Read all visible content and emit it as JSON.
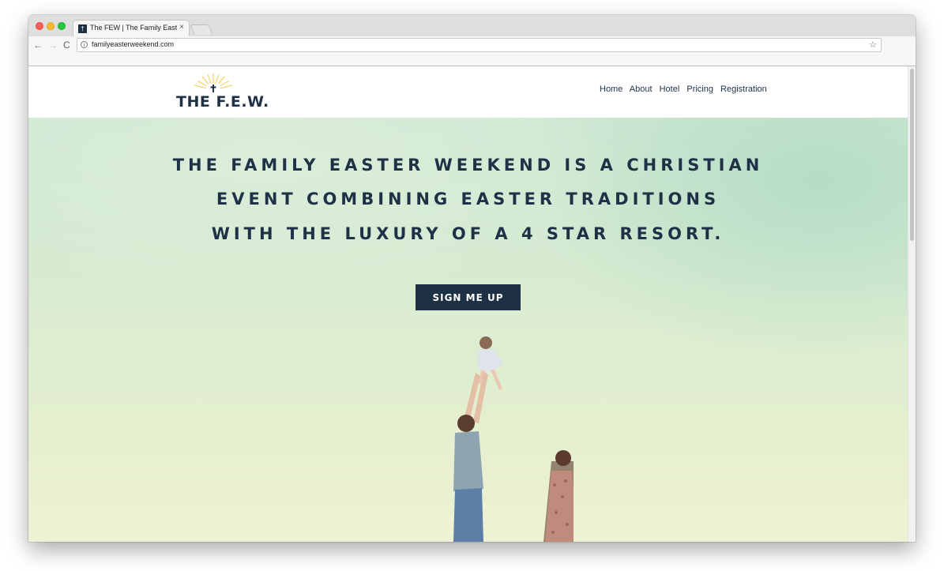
{
  "browser": {
    "tab_title": "The FEW | The Family Easter W",
    "tab_close": "×",
    "favicon_glyph": "†",
    "url": "familyeasterweekend.com",
    "nav_back": "←",
    "nav_forward": "→",
    "nav_reload": "C",
    "info_glyph": "i",
    "star_glyph": "☆"
  },
  "site": {
    "logo_text": "THE F.E.W.",
    "nav": [
      "Home",
      "About",
      "Hotel",
      "Pricing",
      "Registration"
    ]
  },
  "hero": {
    "lines": [
      "THE FAMILY EASTER WEEKEND IS A CHRISTIAN",
      "EVENT COMBINING EASTER TRADITIONS",
      "WITH THE LUXURY OF A 4 STAR RESORT."
    ],
    "cta_label": "SIGN ME UP"
  },
  "colors": {
    "brand_navy": "#1e3044",
    "sky_green": "#cfe8d3",
    "sky_cream": "#eef2d4",
    "logo_rays": "#f2c94c"
  },
  "icons": [
    "info-icon",
    "star-icon",
    "cross-icon",
    "close-icon"
  ]
}
